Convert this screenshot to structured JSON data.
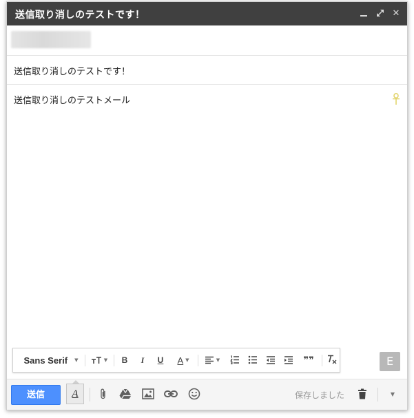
{
  "window": {
    "title": "送信取り消しのテストです！",
    "controls": {
      "minimize_icon": "minimize-icon",
      "popout_icon": "popout-icon",
      "close_icon": "close-icon",
      "close_label": "✕"
    }
  },
  "compose": {
    "recipient_blurred": true,
    "subject": "送信取り消しのテストです！",
    "body": "送信取り消しのテストメール"
  },
  "formatting_toolbar": {
    "font_family": "Sans Serif",
    "items": [
      {
        "name": "font-family-dropdown",
        "icon": "caret-down-icon"
      },
      {
        "name": "font-size-dropdown",
        "icon": "text-size-icon"
      },
      {
        "name": "bold-button",
        "icon": "bold-icon"
      },
      {
        "name": "italic-button",
        "icon": "italic-icon"
      },
      {
        "name": "underline-button",
        "icon": "underline-icon"
      },
      {
        "name": "text-color-dropdown",
        "icon": "text-color-icon"
      },
      {
        "name": "align-dropdown",
        "icon": "align-left-icon"
      },
      {
        "name": "numbered-list-button",
        "icon": "numbered-list-icon"
      },
      {
        "name": "bulleted-list-button",
        "icon": "bulleted-list-icon"
      },
      {
        "name": "indent-less-button",
        "icon": "indent-less-icon"
      },
      {
        "name": "indent-more-button",
        "icon": "indent-more-icon"
      },
      {
        "name": "quote-button",
        "icon": "quote-icon"
      },
      {
        "name": "remove-formatting-button",
        "icon": "clear-format-icon"
      }
    ],
    "bold_label": "B",
    "italic_label": "I",
    "underline_label": "U",
    "text_color_label": "A",
    "quote_label": "❞❞"
  },
  "extension_button": {
    "label": "E"
  },
  "bottom_bar": {
    "send_label": "送信",
    "format_toggle_label": "A",
    "icons": [
      "paperclip-icon",
      "drive-icon",
      "photo-icon",
      "link-icon",
      "emoji-icon"
    ],
    "saved_status": "保存しました",
    "trash_icon": "trash-icon",
    "more_icon": "caret-down-icon"
  },
  "colors": {
    "titlebar": "#404040",
    "send_button": "#4d90fe",
    "ankh_icon": "#e3d56e"
  }
}
